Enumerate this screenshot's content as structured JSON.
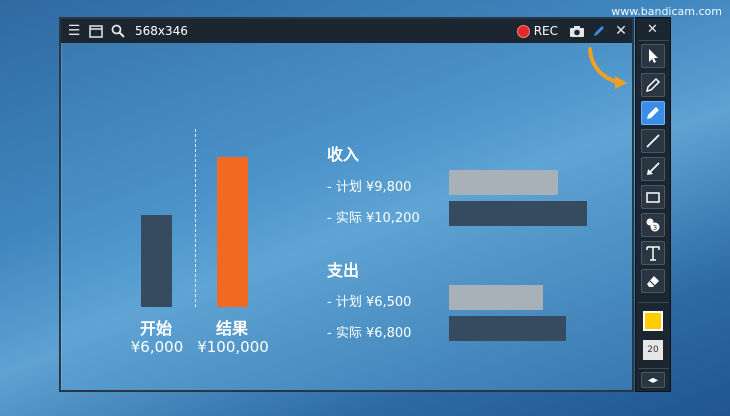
{
  "watermark": "www.bandicam.com",
  "titlebar": {
    "size_label": "568x346",
    "rec_label": "REC"
  },
  "chart_left": {
    "bars": [
      {
        "label": "开始",
        "value": "¥6,000",
        "color": "#364a60"
      },
      {
        "label": "结果",
        "value": "¥100,000",
        "color": "#f26a21"
      }
    ]
  },
  "income": {
    "title": "收入",
    "rows": [
      {
        "label": "- 计划 ¥9,800",
        "value": 9800
      },
      {
        "label": "- 实际 ¥10,200",
        "value": 10200
      }
    ]
  },
  "expense": {
    "title": "支出",
    "rows": [
      {
        "label": "- 计划 ¥6,500",
        "value": 6500
      },
      {
        "label": "- 实际 ¥6,800",
        "value": 6800
      }
    ]
  },
  "toolbar": {
    "tools": [
      "cursor-icon",
      "pencil-icon",
      "highlighter-icon",
      "line-icon",
      "arrow-icon",
      "rectangle-icon",
      "numbering-icon",
      "text-icon",
      "eraser-icon"
    ],
    "active_tool": "highlighter-icon",
    "color": "#ffcc00",
    "size_value": "20"
  },
  "colors": {
    "plan_bar": "#a8b0b8",
    "actual_bar": "#364a60",
    "accent": "#f26a21"
  }
}
